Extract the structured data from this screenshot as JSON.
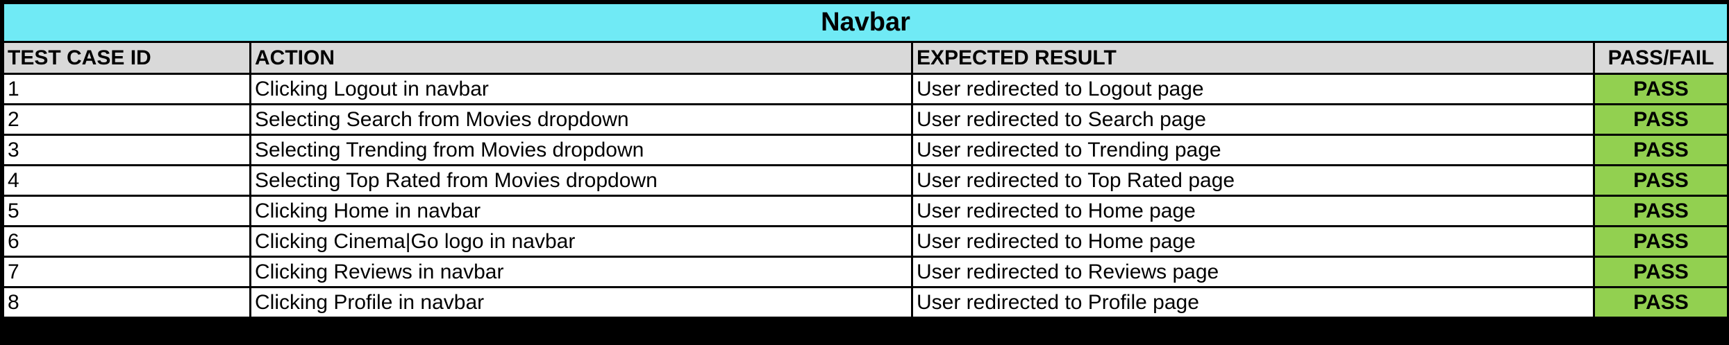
{
  "sheet": {
    "title": "Navbar",
    "headers": {
      "id": "TEST CASE ID",
      "action": "ACTION",
      "expected": "EXPECTED RESULT",
      "status": "PASS/FAIL"
    },
    "rows": [
      {
        "id": "1",
        "action": "Clicking Logout in navbar",
        "expected": "User redirected to Logout page",
        "status": "PASS"
      },
      {
        "id": "2",
        "action": "Selecting Search from Movies dropdown",
        "expected": "User redirected to Search page",
        "status": "PASS"
      },
      {
        "id": "3",
        "action": "Selecting Trending from Movies dropdown",
        "expected": "User redirected to Trending page",
        "status": "PASS"
      },
      {
        "id": "4",
        "action": "Selecting Top Rated from Movies dropdown",
        "expected": "User redirected to Top Rated page",
        "status": "PASS"
      },
      {
        "id": "5",
        "action": "Clicking Home in navbar",
        "expected": "User redirected to Home page",
        "status": "PASS"
      },
      {
        "id": "6",
        "action": "Clicking Cinema|Go logo in navbar",
        "expected": "User redirected to Home page",
        "status": "PASS"
      },
      {
        "id": "7",
        "action": "Clicking Reviews in navbar",
        "expected": "User redirected to Reviews page",
        "status": "PASS"
      },
      {
        "id": "8",
        "action": "Clicking Profile in navbar",
        "expected": "User redirected to Profile page",
        "status": "PASS"
      }
    ]
  },
  "colors": {
    "title_bg": "#70eaf5",
    "header_bg": "#d9d9d9",
    "pass_bg": "#92d050",
    "border": "#000000"
  }
}
